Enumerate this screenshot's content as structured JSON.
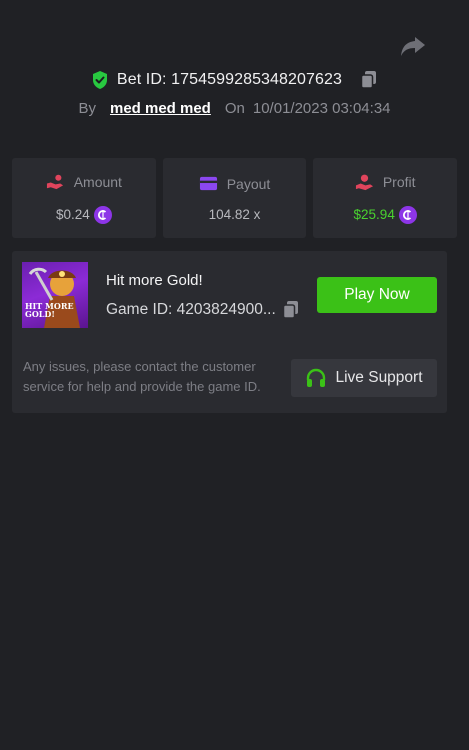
{
  "header": {
    "bet_id_label": "Bet ID:",
    "bet_id": "1754599285348207623",
    "by_label": "By",
    "username": "med med med",
    "on_label": "On",
    "datetime": "10/01/2023 03:04:34"
  },
  "stats": {
    "amount": {
      "label": "Amount",
      "value": "$0.24",
      "icon": "hand-coins-icon",
      "color": "#e0445c"
    },
    "payout": {
      "label": "Payout",
      "value": "104.82 x",
      "icon": "card-icon",
      "color": "#8b47f0"
    },
    "profit": {
      "label": "Profit",
      "value": "$25.94",
      "icon": "hand-money-icon",
      "color": "#e0445c",
      "value_color": "#49d22f"
    }
  },
  "game": {
    "title": "Hit more Gold!",
    "thumbnail_text": "HIT MORE GOLD!",
    "id_label": "Game ID:",
    "id_value": "4203824900...",
    "play_label": "Play Now",
    "support_text": "Any issues, please contact the customer service for help and provide the game ID.",
    "support_label": "Live Support"
  },
  "colors": {
    "background": "#202125",
    "card": "#2a2b30",
    "accent_green": "#3bc117",
    "coin_purple": "#8d35e8",
    "verified_green": "#28c840"
  }
}
